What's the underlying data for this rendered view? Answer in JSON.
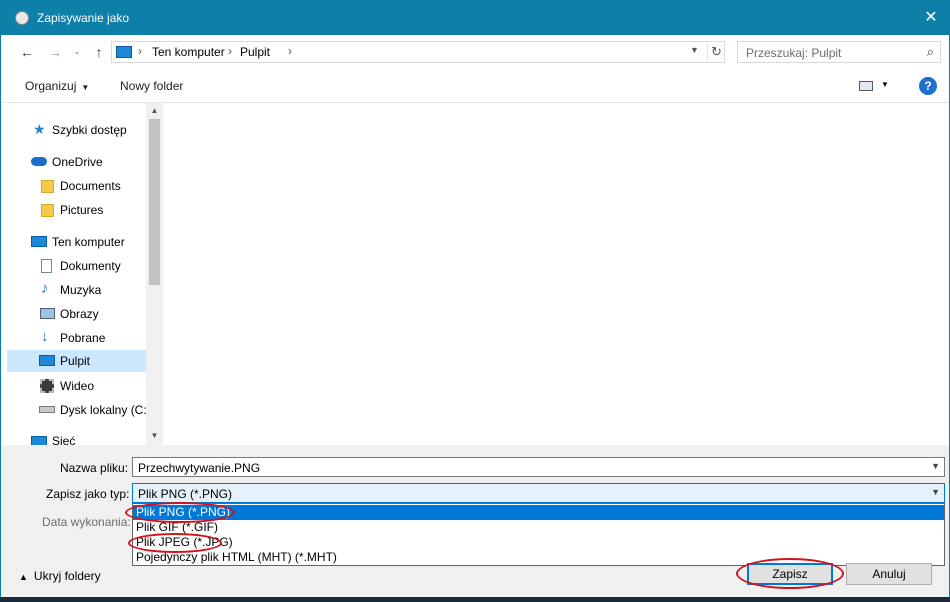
{
  "window": {
    "title": "Zapisywanie jako",
    "close_label": "✕"
  },
  "nav": {
    "back": "←",
    "forward": "→",
    "up": "↑"
  },
  "address": {
    "crumbs": [
      "Ten komputer",
      "Pulpit"
    ],
    "separator": "›",
    "refresh": "↻"
  },
  "search": {
    "placeholder": "Przeszukaj: Pulpit",
    "icon": "search-icon"
  },
  "toolbar": {
    "organize_label": "Organizuj",
    "new_folder_label": "Nowy folder",
    "help_label": "?"
  },
  "sidebar": {
    "items": [
      {
        "label": "Szybki dostęp",
        "icon": "star-icon"
      },
      {
        "label": "OneDrive",
        "icon": "cloud-icon"
      },
      {
        "label": "Documents",
        "icon": "folder-icon"
      },
      {
        "label": "Pictures",
        "icon": "folder-icon"
      },
      {
        "label": "Ten komputer",
        "icon": "computer-icon"
      },
      {
        "label": "Dokumenty",
        "icon": "document-icon"
      },
      {
        "label": "Muzyka",
        "icon": "music-icon"
      },
      {
        "label": "Obrazy",
        "icon": "pictures-icon"
      },
      {
        "label": "Pobrane",
        "icon": "download-icon"
      },
      {
        "label": "Pulpit",
        "icon": "desktop-icon",
        "selected": true
      },
      {
        "label": "Wideo",
        "icon": "video-icon"
      },
      {
        "label": "Dysk lokalny (C:)",
        "icon": "drive-icon"
      },
      {
        "label": "Sieć",
        "icon": "network-icon"
      }
    ]
  },
  "form": {
    "filename_label": "Nazwa pliku:",
    "filename_value": "Przechwytywanie.PNG",
    "filetype_label": "Zapisz jako typ:",
    "filetype_value": "Plik PNG (*.PNG)",
    "date_label": "Data wykonania:",
    "filetype_options": [
      "Plik PNG (*.PNG)",
      "Plik GIF (*.GIF)",
      "Plik JPEG (*.JPG)",
      "Pojedynczy plik HTML (MHT) (*.MHT)"
    ]
  },
  "footer": {
    "hide_folders_label": "Ukryj foldery",
    "save_label": "Zapisz",
    "cancel_label": "Anuluj"
  },
  "colors": {
    "titlebar": "#0d7fa8",
    "selection": "#0078d7",
    "highlight_ring": "#d0141e",
    "sidebar_selected": "#cce8ff"
  }
}
